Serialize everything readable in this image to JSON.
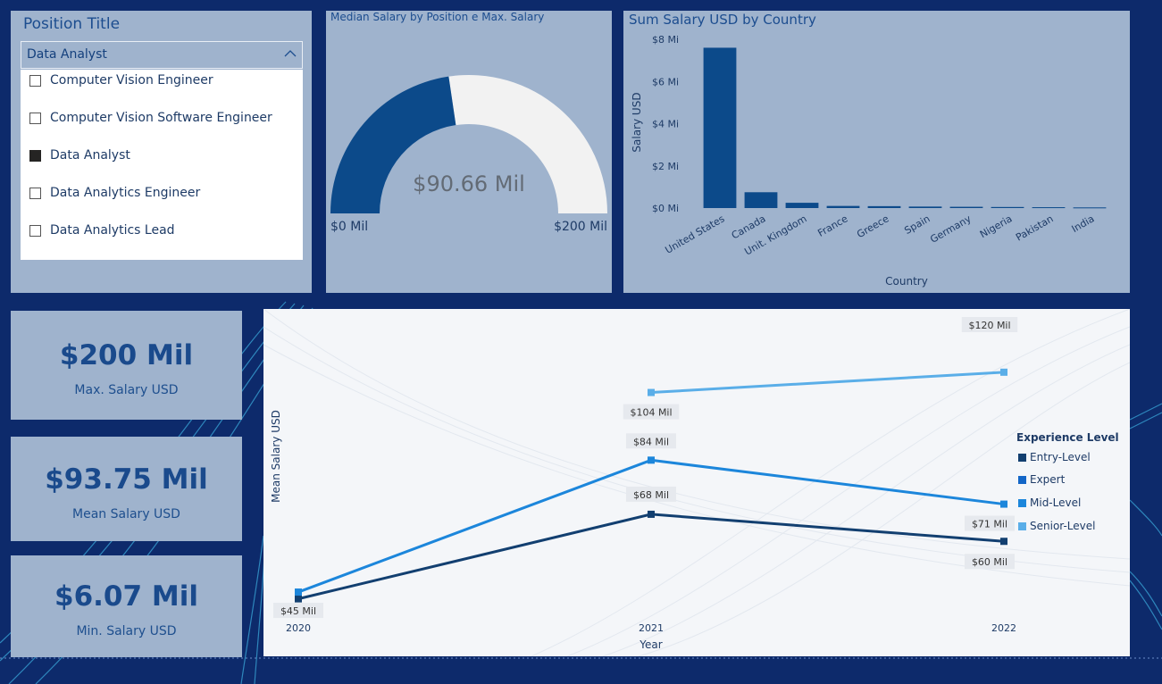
{
  "slicer": {
    "title": "Position Title",
    "selected_value": "Data Analyst",
    "items": [
      {
        "label": "Computer Vision Engineer",
        "checked": false
      },
      {
        "label": "Computer Vision Software Engineer",
        "checked": false
      },
      {
        "label": "Data Analyst",
        "checked": true
      },
      {
        "label": "Data Analytics Engineer",
        "checked": false
      },
      {
        "label": "Data Analytics Lead",
        "checked": false
      }
    ]
  },
  "gauge": {
    "title": "Median Salary by Position e Max. Salary",
    "value_label": "$90.66 Mil",
    "min_label": "$0 Mil",
    "max_label": "$200 Mil",
    "value": 90.66,
    "min": 0,
    "max": 200,
    "fill_color": "#0c4a8a",
    "track_color": "#f2f2f2"
  },
  "kpis": [
    {
      "value": "$200 Mil",
      "label": "Max. Salary USD"
    },
    {
      "value": "$93.75 Mil",
      "label": "Mean Salary USD"
    },
    {
      "value": "$6.07 Mil",
      "label": "Min. Salary USD"
    }
  ],
  "colors": {
    "background": "#0d2a6b",
    "panel": "#9fb3cd",
    "bar": "#0c4a8a",
    "text_dark": "#1e3b66"
  },
  "chart_data": [
    {
      "type": "bar",
      "title": "Sum Salary USD by Country",
      "xlabel": "Country",
      "ylabel": "Salary USD",
      "categories": [
        "United States",
        "Canada",
        "Unit. Kingdom",
        "France",
        "Greece",
        "Spain",
        "Germany",
        "Nigeria",
        "Pakistan",
        "India"
      ],
      "values": [
        7.6,
        0.75,
        0.25,
        0.1,
        0.09,
        0.07,
        0.06,
        0.05,
        0.04,
        0.03
      ],
      "ylim": [
        0,
        8
      ],
      "yticks": [
        0,
        2,
        4,
        6,
        8
      ],
      "ytick_labels": [
        "$0 Mi",
        "$2 Mi",
        "$4 Mi",
        "$6 Mi",
        "$8 Mi"
      ],
      "unit": "Mi"
    },
    {
      "type": "line",
      "xlabel": "Year",
      "ylabel": "Mean Salary USD",
      "x": [
        "2020",
        "2021",
        "2022"
      ],
      "ylim": [
        40,
        125
      ],
      "legend_title": "Experience Level",
      "legend_position": "right",
      "series": [
        {
          "name": "Entry-Level",
          "color": "#123f70",
          "values": [
            43,
            68,
            60
          ],
          "labels": [
            "",
            "$68 Mil",
            "$60 Mil"
          ]
        },
        {
          "name": "Expert",
          "color": "#1366c7",
          "values": [
            null,
            null,
            125
          ],
          "labels": [
            "",
            "",
            "$120 Mil"
          ]
        },
        {
          "name": "Mid-Level",
          "color": "#1c86db",
          "values": [
            45,
            84,
            71
          ],
          "labels": [
            "$45 Mil",
            "$84 Mil",
            "$71 Mil"
          ]
        },
        {
          "name": "Senior-Level",
          "color": "#5aaee8",
          "values": [
            null,
            104,
            110
          ],
          "labels": [
            "",
            "$104 Mil",
            ""
          ]
        }
      ]
    }
  ]
}
